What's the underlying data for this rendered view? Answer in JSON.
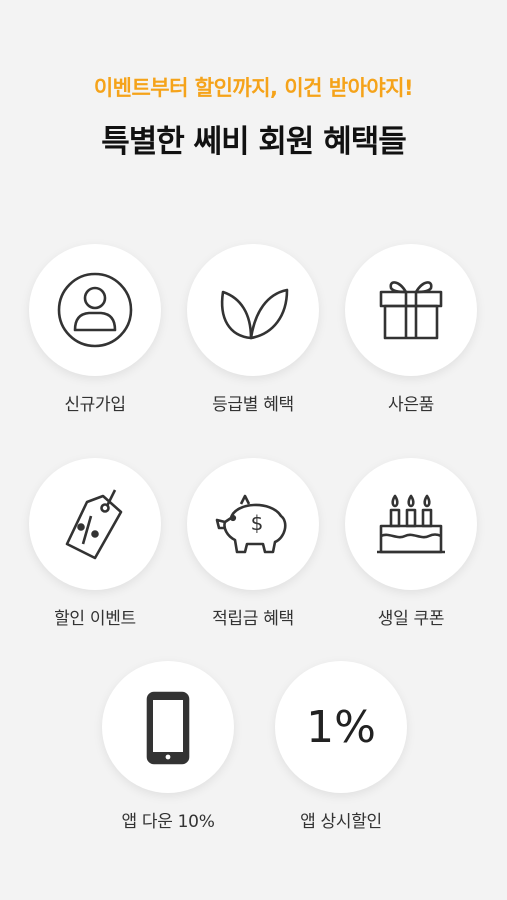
{
  "header": {
    "subtitle": "이벤트부터 할인까지, 이건 받아야지!",
    "title": "특별한 쎄비 회원 혜택들"
  },
  "benefits": [
    {
      "label": "신규가입",
      "icon": "person-icon"
    },
    {
      "label": "등급별 혜택",
      "icon": "leaf-icon"
    },
    {
      "label": "사은품",
      "icon": "gift-icon"
    },
    {
      "label": "할인 이벤트",
      "icon": "price-tag-icon"
    },
    {
      "label": "적립금 혜택",
      "icon": "piggy-bank-icon"
    },
    {
      "label": "생일 쿠폰",
      "icon": "birthday-cake-icon"
    },
    {
      "label": "앱 다운 10%",
      "icon": "smartphone-icon"
    },
    {
      "label": "앱 상시할인",
      "icon": "percent-icon",
      "icon_text": "1%"
    }
  ],
  "colors": {
    "accent": "#f5a31a",
    "background": "#f3f3f3",
    "circle": "#ffffff"
  }
}
